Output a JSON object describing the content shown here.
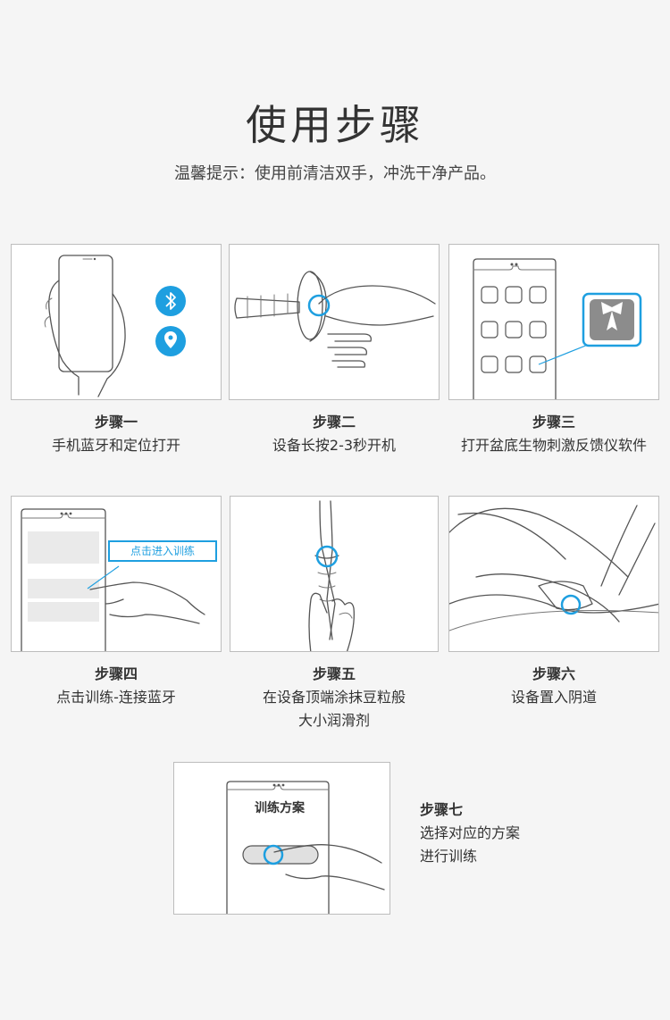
{
  "title": "使用步骤",
  "subtitle": "温馨提示：使用前清洁双手，冲洗干净产品。",
  "accent_color": "#1e9fe0",
  "steps": [
    {
      "heading": "步骤一",
      "text": "手机蓝牙和定位打开",
      "icons": [
        "bluetooth-icon",
        "location-icon"
      ]
    },
    {
      "heading": "步骤二",
      "text": "设备长按2-3秒开机"
    },
    {
      "heading": "步骤三",
      "text": "打开盆底生物刺激反馈仪软件"
    },
    {
      "heading": "步骤四",
      "text": "点击训练-连接蓝牙",
      "callout": "点击进入训练"
    },
    {
      "heading": "步骤五",
      "text_line1": "在设备顶端涂抹豆粒般",
      "text_line2": "大小润滑剂"
    },
    {
      "heading": "步骤六",
      "text": "设备置入阴道"
    },
    {
      "heading": "步骤七",
      "text_line1": "选择对应的方案",
      "text_line2": "进行训练",
      "screen_title": "训练方案"
    }
  ]
}
